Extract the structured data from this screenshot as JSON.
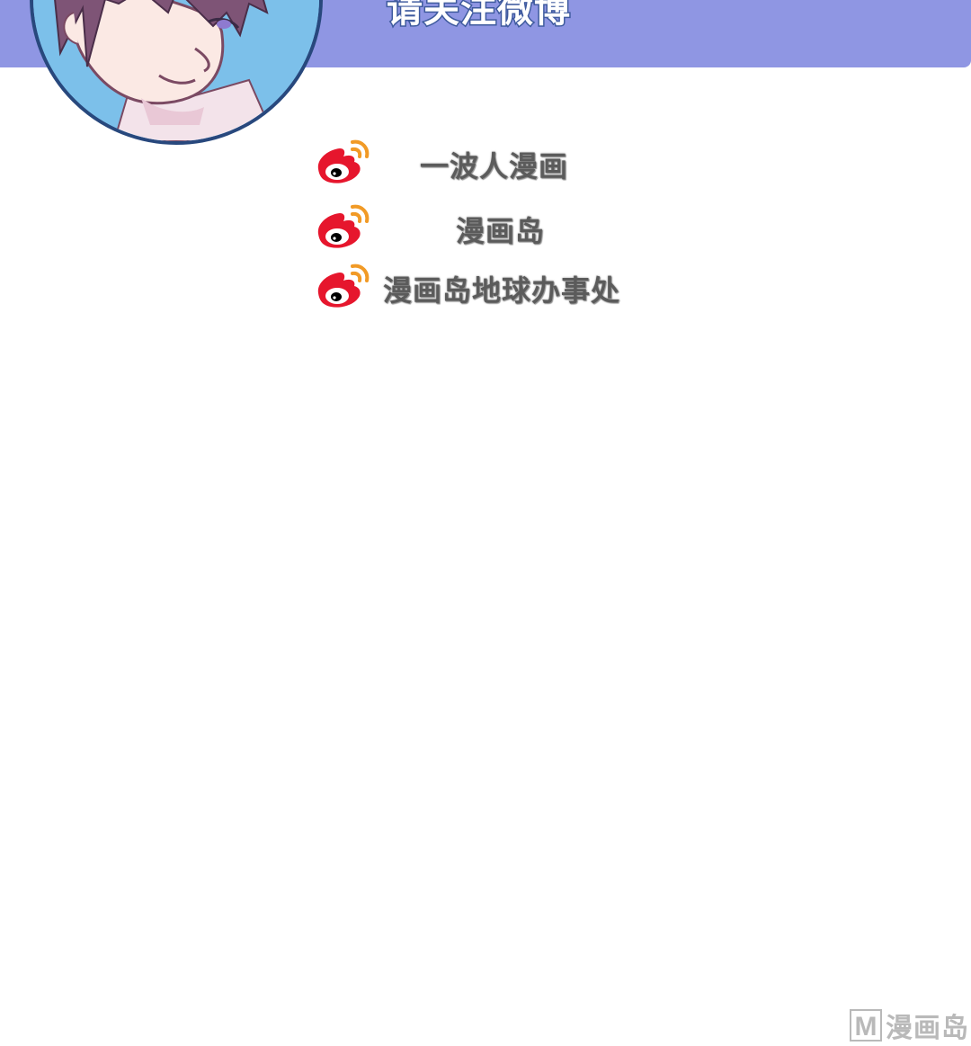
{
  "banner": {
    "title": "请关注微博",
    "color": "#8f96e3"
  },
  "avatar": {
    "icon": "character-portrait"
  },
  "weibo_accounts": [
    {
      "icon": "weibo-icon",
      "label": "一波人漫画"
    },
    {
      "icon": "weibo-icon",
      "label": "漫画岛"
    },
    {
      "icon": "weibo-icon",
      "label": "漫画岛地球办事处"
    }
  ],
  "watermark": {
    "logo_letter": "M",
    "text": "漫画岛"
  }
}
